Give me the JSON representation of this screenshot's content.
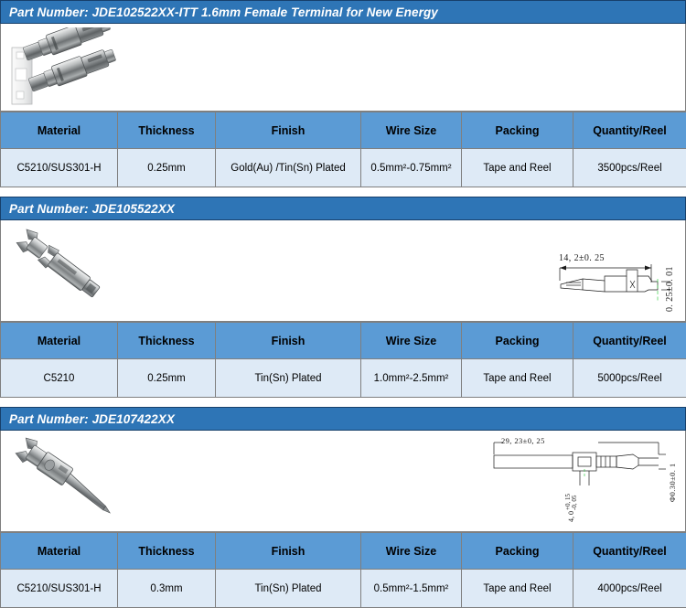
{
  "sections": [
    {
      "banner": "Part Number: JDE102522XX-ITT 1.6mm Female Terminal for New Energy",
      "visual_type": "photo",
      "photo_alt": "two-female-terminals-on-carrier-strip",
      "columns": [
        "Material",
        "Thickness",
        "Finish",
        "Wire Size",
        "Packing",
        "Quantity/Reel"
      ],
      "values": [
        "C5210/SUS301-H",
        "0.25mm",
        "Gold(Au) /Tin(Sn) Plated",
        "0.5mm²-0.75mm²",
        "Tape and Reel",
        "3500pcs/Reel"
      ],
      "drawing": null
    },
    {
      "banner": "Part Number: JDE105522XX",
      "visual_type": "photo-and-drawing",
      "photo_alt": "single-female-terminal",
      "columns": [
        "Material",
        "Thickness",
        "Finish",
        "Wire Size",
        "Packing",
        "Quantity/Reel"
      ],
      "values": [
        "C5210",
        "0.25mm",
        "Tin(Sn) Plated",
        "1.0mm²-2.5mm²",
        "Tape and Reel",
        "5000pcs/Reel"
      ],
      "drawing": {
        "length_dim": "14, 2±0. 25",
        "height_dim": "0. 25±0. 01"
      }
    },
    {
      "banner": "Part Number: JDE107422XX",
      "visual_type": "photo-and-drawing",
      "photo_alt": "single-male-pin-terminal",
      "columns": [
        "Material",
        "Thickness",
        "Finish",
        "Wire Size",
        "Packing",
        "Quantity/Reel"
      ],
      "values": [
        "C5210/SUS301-H",
        "0.3mm",
        "Tin(Sn) Plated",
        "0.5mm²-1.5mm²",
        "Tape and Reel",
        "4000pcs/Reel"
      ],
      "drawing": {
        "length_dim": "29, 23±0, 25",
        "diameter_dim": "Φ0.30±0. 1",
        "tol_main": "4, 0",
        "tol_plus": "+0, 15",
        "tol_minus": "-0, 05"
      }
    }
  ],
  "colors": {
    "banner_blue": "#2E75B6",
    "header_blue": "#5B9BD5",
    "cell_blue": "#DEEAF6",
    "border_gray": "#7f7f7f"
  }
}
